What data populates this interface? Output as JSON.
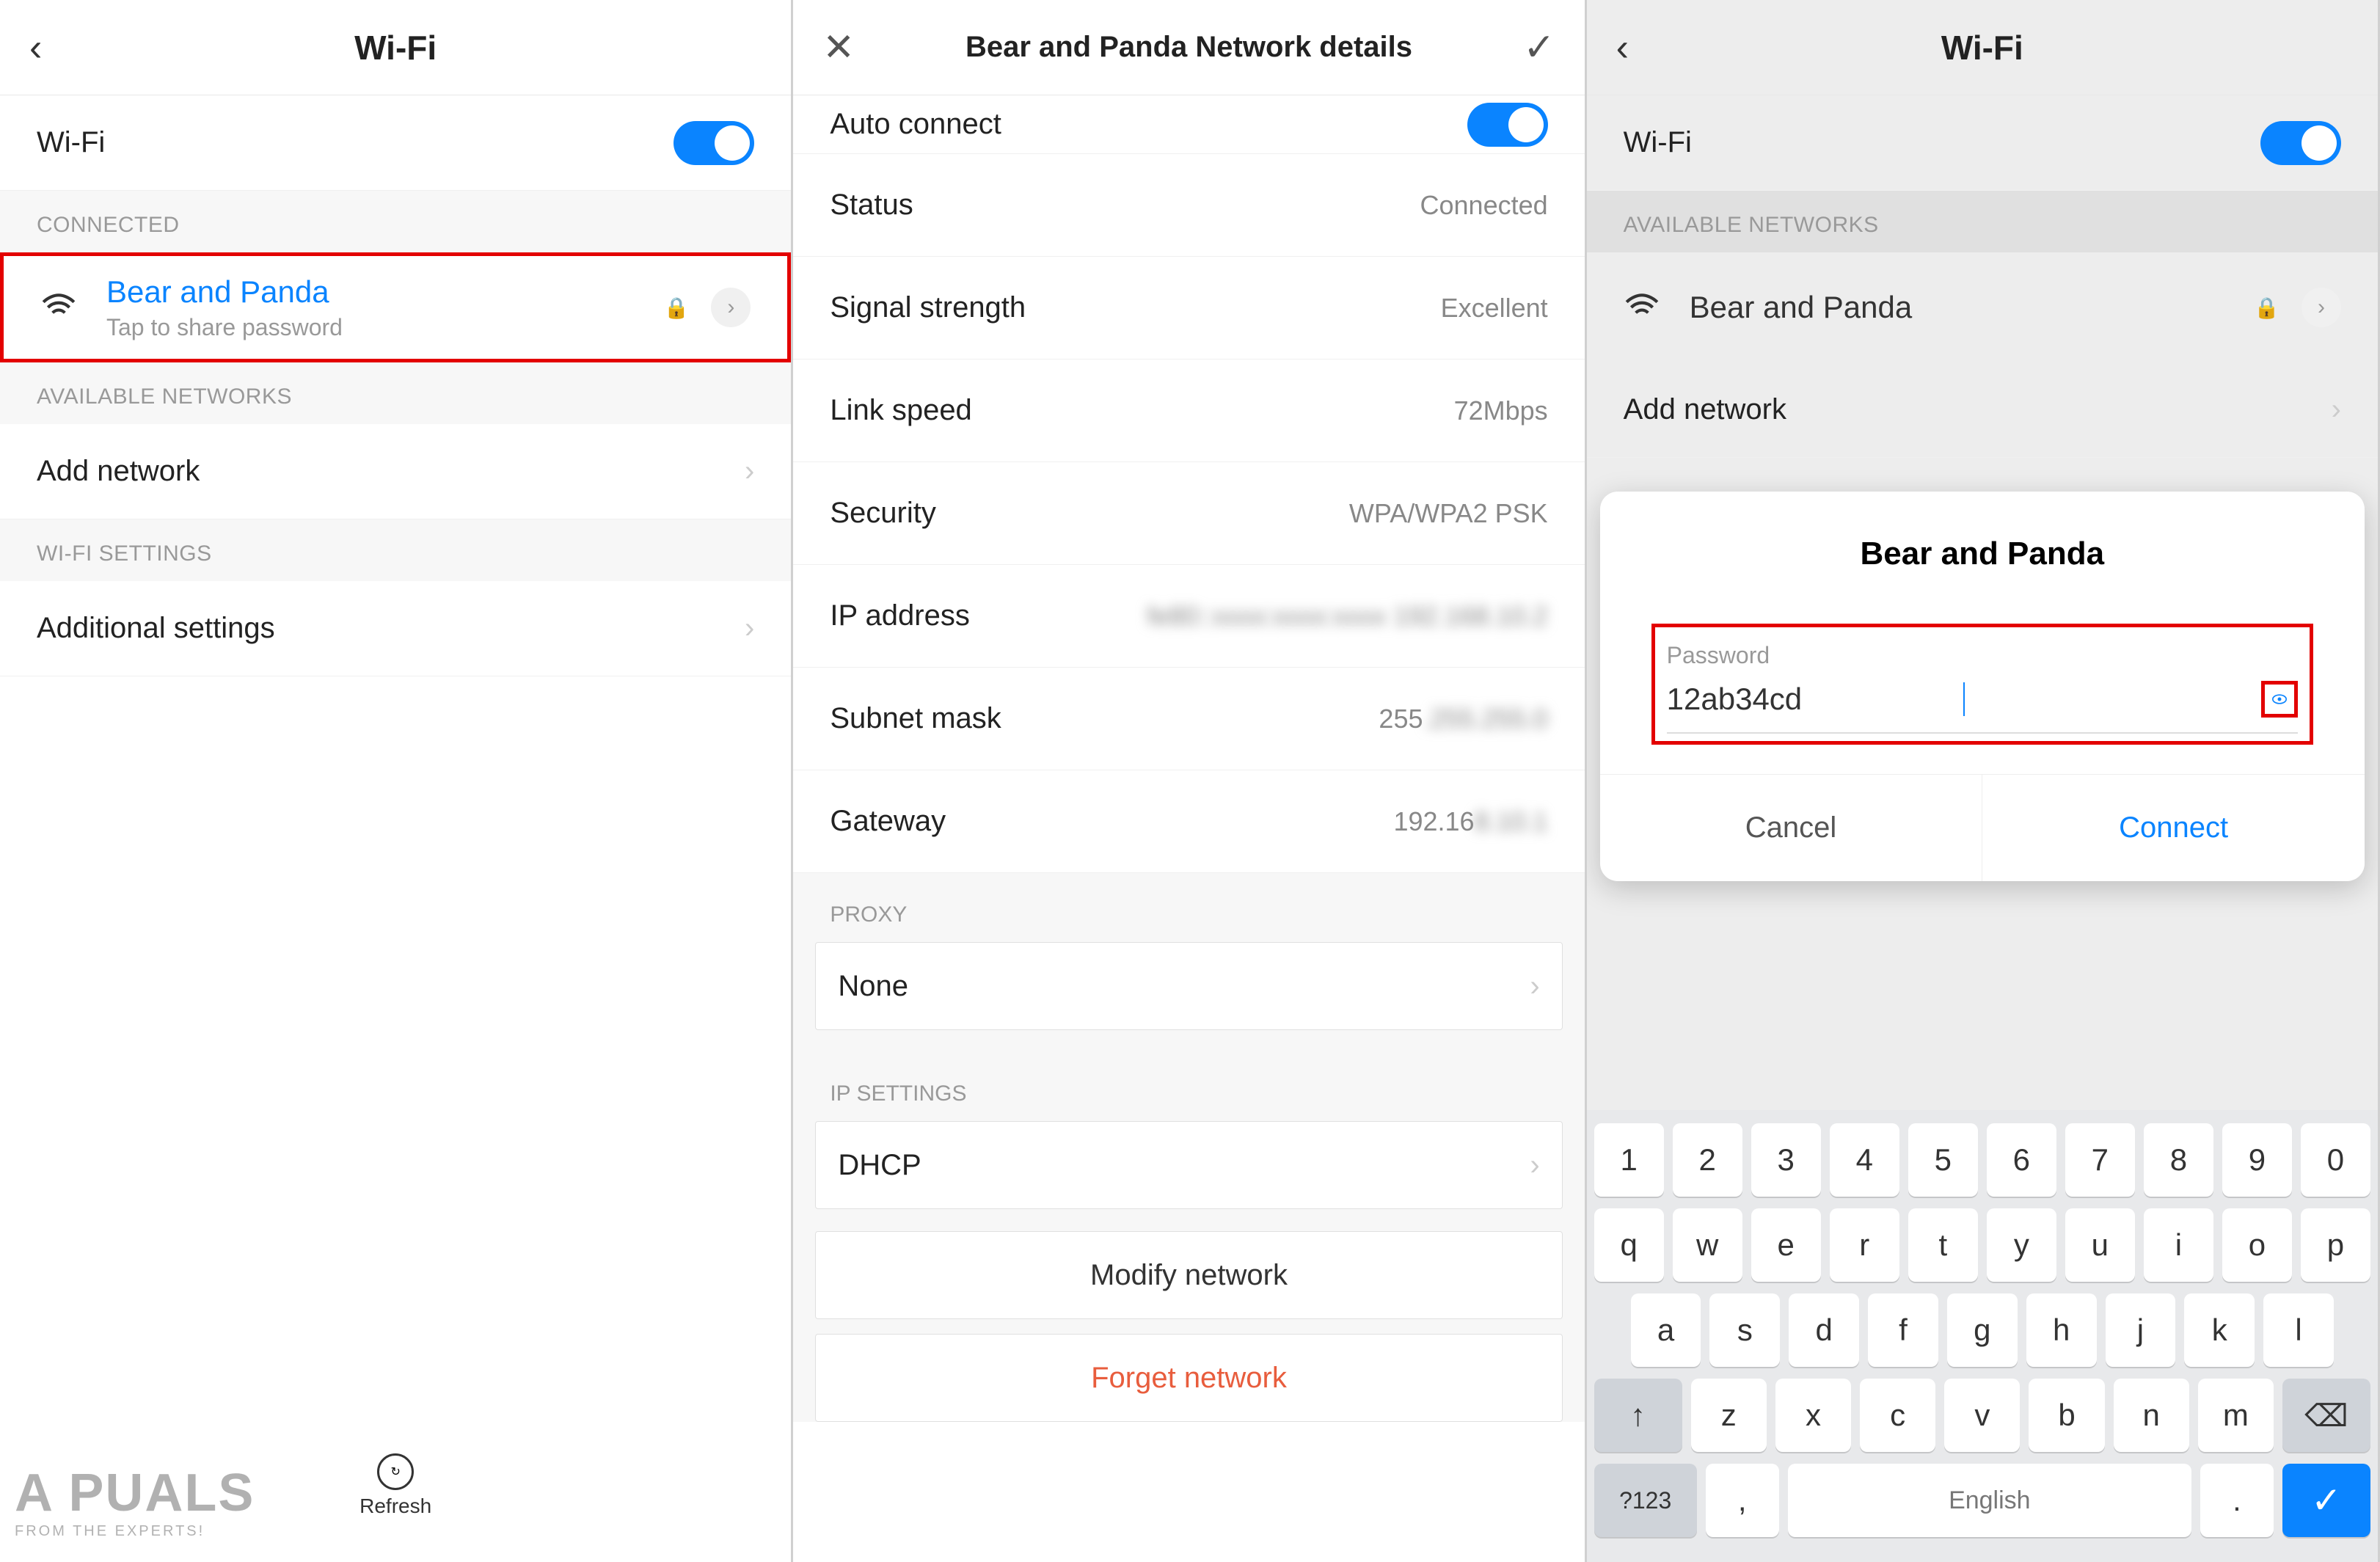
{
  "panel1": {
    "title": "Wi-Fi",
    "wifi_toggle_label": "Wi-Fi",
    "section_connected": "CONNECTED",
    "connected": {
      "name": "Bear and Panda",
      "subtitle": "Tap to share password"
    },
    "section_available": "AVAILABLE NETWORKS",
    "add_network": "Add network",
    "section_settings": "WI-FI SETTINGS",
    "additional_settings": "Additional settings",
    "refresh": "Refresh"
  },
  "panel2": {
    "title": "Bear and Panda Network details",
    "auto_connect": "Auto connect",
    "rows": {
      "status_l": "Status",
      "status_v": "Connected",
      "signal_l": "Signal strength",
      "signal_v": "Excellent",
      "link_l": "Link speed",
      "link_v": "72Mbps",
      "security_l": "Security",
      "security_v": "WPA/WPA2 PSK",
      "ip_l": "IP address",
      "ip_v": "fe80::xxxx:xxxx:xxxx  192.168.10.2",
      "subnet_l": "Subnet mask",
      "subnet_v": "255.255.255.0",
      "gateway_l": "Gateway",
      "gateway_v": "192.168.10.1"
    },
    "proxy_section": "PROXY",
    "proxy_value": "None",
    "ip_settings_section": "IP SETTINGS",
    "ip_settings_value": "DHCP",
    "modify": "Modify network",
    "forget": "Forget network"
  },
  "panel3": {
    "title": "Wi-Fi",
    "wifi_toggle_label": "Wi-Fi",
    "section_available": "AVAILABLE NETWORKS",
    "network": "Bear and Panda",
    "add_network": "Add network",
    "dialog": {
      "title": "Bear and Panda",
      "password_label": "Password",
      "password_value": "12ab34cd",
      "cancel": "Cancel",
      "connect": "Connect"
    },
    "keyboard": {
      "row_num": [
        "1",
        "2",
        "3",
        "4",
        "5",
        "6",
        "7",
        "8",
        "9",
        "0"
      ],
      "row_q": [
        "q",
        "w",
        "e",
        "r",
        "t",
        "y",
        "u",
        "i",
        "o",
        "p"
      ],
      "row_a": [
        "a",
        "s",
        "d",
        "f",
        "g",
        "h",
        "j",
        "k",
        "l"
      ],
      "row_z": [
        "z",
        "x",
        "c",
        "v",
        "b",
        "n",
        "m"
      ],
      "shift": "↑",
      "backspace": "⌫",
      "sym": "?123",
      "comma": ",",
      "space": "English",
      "period": ".",
      "enter": "✓"
    }
  },
  "watermark": {
    "brand": "A  PUALS",
    "tag": "FROM THE EXPERTS!"
  }
}
